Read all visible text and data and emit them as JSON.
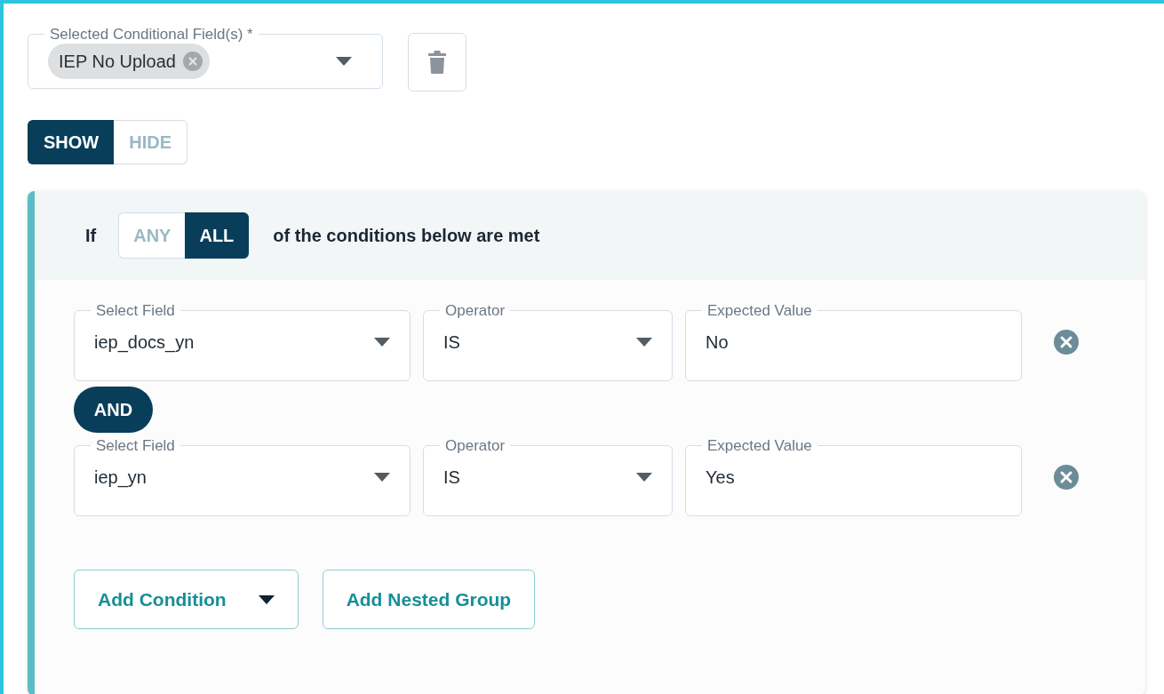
{
  "selected_fields": {
    "label": "Selected Conditional Field(s) *",
    "chips": [
      {
        "text": "IEP No Upload"
      }
    ]
  },
  "visibility": [
    {
      "label": "SHOW",
      "selected": true
    },
    {
      "label": "HIDE",
      "selected": false
    }
  ],
  "match": {
    "prefix": "If",
    "options": [
      {
        "label": "ANY",
        "selected": false
      },
      {
        "label": "ALL",
        "selected": true
      }
    ],
    "suffix": "of the conditions below are met"
  },
  "conditions": [
    {
      "field": {
        "label": "Select Field",
        "value": "iep_docs_yn"
      },
      "operator": {
        "label": "Operator",
        "value": "IS"
      },
      "expected": {
        "label": "Expected Value",
        "value": "No"
      }
    },
    {
      "field": {
        "label": "Select Field",
        "value": "iep_yn"
      },
      "operator": {
        "label": "Operator",
        "value": "IS"
      },
      "expected": {
        "label": "Expected Value",
        "value": "Yes"
      }
    }
  ],
  "connector": "AND",
  "buttons": [
    {
      "label": "Add Condition",
      "kind": "dropdown"
    },
    {
      "label": "Add Nested Group",
      "kind": "plain"
    }
  ]
}
